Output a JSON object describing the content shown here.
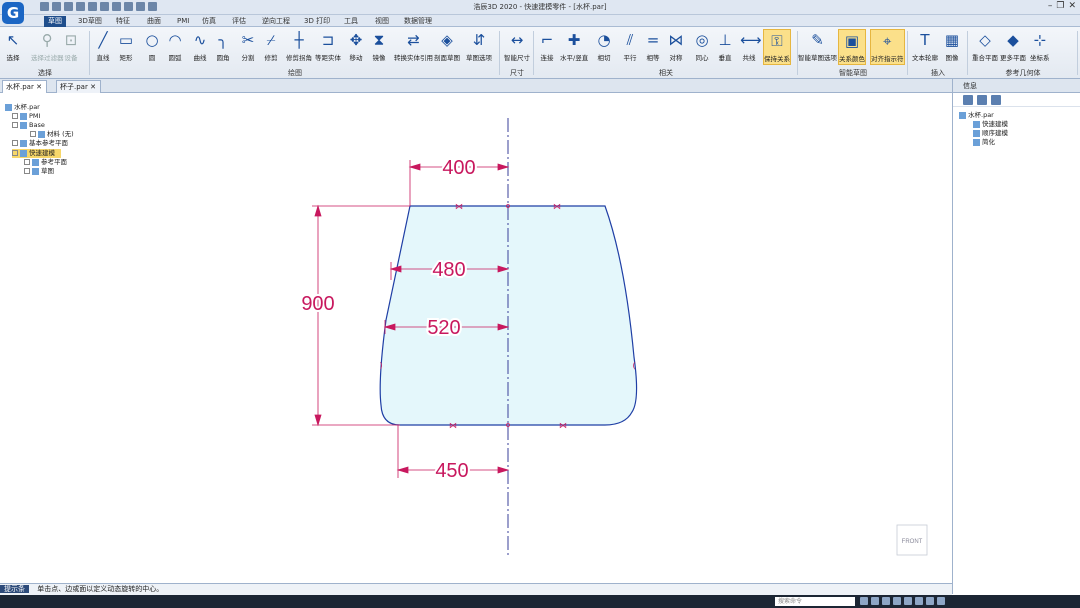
{
  "app": {
    "logo": "G",
    "title": "浩辰3D 2020 - 快速建模零件 - [水杯.par]"
  },
  "menu_tabs": [
    "草图",
    "3D草图",
    "特征",
    "曲面",
    "PMI",
    "仿真",
    "评估",
    "逆向工程",
    "3D 打印",
    "工具",
    "视图",
    "数据管理"
  ],
  "ribbon": {
    "buttons": [
      {
        "label": "选择",
        "icon": "↖",
        "state": "normal"
      },
      {
        "label": "选择过滤器",
        "icon": "⚲",
        "state": "disabled"
      },
      {
        "label": "设备",
        "icon": "⊡",
        "state": "disabled"
      },
      {
        "label": "直线",
        "icon": "╱",
        "state": "normal"
      },
      {
        "label": "矩形",
        "icon": "▭",
        "state": "normal"
      },
      {
        "label": "圆",
        "icon": "○",
        "state": "normal"
      },
      {
        "label": "圆弧",
        "icon": "◠",
        "state": "normal"
      },
      {
        "label": "曲线",
        "icon": "∿",
        "state": "normal"
      },
      {
        "label": "圆角",
        "icon": "╮",
        "state": "normal"
      },
      {
        "label": "分割",
        "icon": "✂",
        "state": "normal"
      },
      {
        "label": "修剪",
        "icon": "⌿",
        "state": "normal"
      },
      {
        "label": "修剪拐角",
        "icon": "┼",
        "state": "normal"
      },
      {
        "label": "等距实体",
        "icon": "⊐",
        "state": "normal"
      },
      {
        "label": "移动",
        "icon": "✥",
        "state": "normal"
      },
      {
        "label": "镜像",
        "icon": "⧗",
        "state": "normal"
      },
      {
        "label": "转换实体引用",
        "icon": "⇄",
        "state": "normal"
      },
      {
        "label": "剖面草图",
        "icon": "◈",
        "state": "normal"
      },
      {
        "label": "草图选项",
        "icon": "⇵",
        "state": "normal"
      },
      {
        "label": "智能尺寸",
        "icon": "↔",
        "state": "normal"
      },
      {
        "label": "连接",
        "icon": "⌐",
        "state": "normal"
      },
      {
        "label": "水平/竖直",
        "icon": "✚",
        "state": "normal"
      },
      {
        "label": "相切",
        "icon": "◔",
        "state": "normal"
      },
      {
        "label": "平行",
        "icon": "⫽",
        "state": "normal"
      },
      {
        "label": "相等",
        "icon": "=",
        "state": "normal"
      },
      {
        "label": "对称",
        "icon": "⋈",
        "state": "normal"
      },
      {
        "label": "同心",
        "icon": "◎",
        "state": "normal"
      },
      {
        "label": "垂直",
        "icon": "⊥",
        "state": "normal"
      },
      {
        "label": "共线",
        "icon": "⟷",
        "state": "normal"
      },
      {
        "label": "保持关系",
        "icon": "⚿",
        "state": "highlight"
      },
      {
        "label": "智能草图选项",
        "icon": "✎",
        "state": "normal"
      },
      {
        "label": "关系颜色",
        "icon": "▣",
        "state": "highlight"
      },
      {
        "label": "对齐指示符",
        "icon": "⌖",
        "state": "highlight"
      },
      {
        "label": "文本轮廓",
        "icon": "T",
        "state": "normal"
      },
      {
        "label": "图像",
        "icon": "▦",
        "state": "normal"
      },
      {
        "label": "重合平面",
        "icon": "◇",
        "state": "normal"
      },
      {
        "label": "更多平面",
        "icon": "◆",
        "state": "normal"
      },
      {
        "label": "坐标系",
        "icon": "⊹",
        "state": "normal"
      }
    ],
    "groups": [
      "选择",
      "绘图",
      "尺寸",
      "相关",
      "智能草图",
      "插入",
      "参考几何体"
    ]
  },
  "doc_tabs": [
    "水杯.par",
    "杯子.par"
  ],
  "feature_tree": {
    "items": [
      {
        "label": "水杯.par"
      },
      {
        "label": "PMI"
      },
      {
        "label": "Base"
      },
      {
        "label": "材料 (无)"
      },
      {
        "label": "基本参考平面"
      },
      {
        "label": "快速建模"
      },
      {
        "label": "参考平面"
      },
      {
        "label": "草图"
      }
    ]
  },
  "sketch": {
    "dimensions": [
      {
        "name": "top-half-width",
        "value": "400"
      },
      {
        "name": "upper-half-width",
        "value": "480"
      },
      {
        "name": "mid-half-width",
        "value": "520"
      },
      {
        "name": "height",
        "value": "900"
      },
      {
        "name": "bottom-half-width",
        "value": "450"
      }
    ],
    "view_cube_label": "FRONT",
    "colors": {
      "profile": "#1f3fa5",
      "fill": "#e4f7fb",
      "dimension": "#c8185e",
      "centerline": "#3a3f9a"
    }
  },
  "right_panel": {
    "title": "信息",
    "items": [
      {
        "label": "水杯.par"
      },
      {
        "label": "快速建模"
      },
      {
        "label": "顺序建模"
      },
      {
        "label": "简化"
      }
    ]
  },
  "status_bar": {
    "label": "提示条",
    "prompt": "单击点、边或面以定义动态旋转的中心。"
  },
  "taskbar": {
    "search_placeholder": "搜索命令"
  }
}
